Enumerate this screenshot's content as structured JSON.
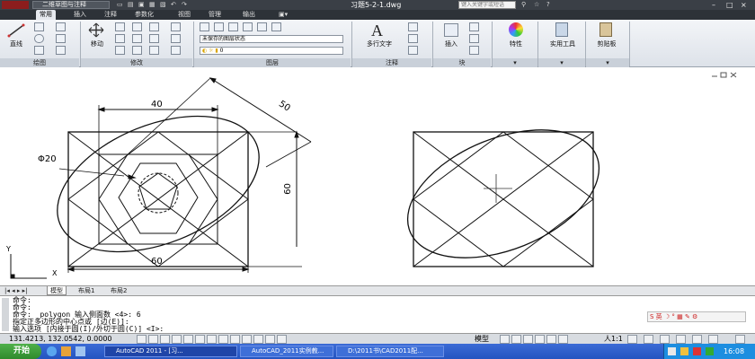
{
  "titlebar": {
    "workspace": "二维草图与注释",
    "document": "习题5-2-1.dwg",
    "search_placeholder": "键入关键字或短语",
    "controls": [
      "–",
      "□",
      "×"
    ]
  },
  "menu": {
    "tabs": [
      "常用",
      "插入",
      "注释",
      "参数化",
      "视图",
      "管理",
      "输出"
    ],
    "active": "常用"
  },
  "ribbon": {
    "tools": {
      "line": "直线",
      "move": "移动",
      "mtext": "多行文字",
      "insert": "插入",
      "properties": "特性",
      "utilities": "实用工具",
      "clipboard": "剪贴板"
    },
    "layer_state": "未保存的图层状态",
    "layer_current": "0",
    "panels": [
      "绘图",
      "修改",
      "图层",
      "注释",
      "块"
    ]
  },
  "drawing": {
    "dim_top": "40",
    "dim_diag": "50",
    "dim_circle": "Φ20",
    "dim_right": "60",
    "dim_bottom": "60",
    "ucs_y": "Y",
    "ucs_x": "X"
  },
  "layout_tabs": [
    "模型",
    "布局1",
    "布局2"
  ],
  "command": {
    "lines": [
      "命令:",
      "命令:",
      "命令: _polygon 输入侧面数 <4>: 6",
      "指定正多边形的中心点或 [边(E)]:",
      "输入选项 [内接于圆(I)/外切于圆(C)] <I>:"
    ]
  },
  "status": {
    "coords": "131.4213, 132.0542, 0.0000",
    "model": "模型",
    "scale": "人1:1"
  },
  "taskbar": {
    "start": "开始",
    "tasks": [
      "AutoCAD 2011 - [习...",
      "AutoCAD_2011实例教...",
      "D:\\2011书\\CAD2011配..."
    ],
    "time": "16:08"
  }
}
